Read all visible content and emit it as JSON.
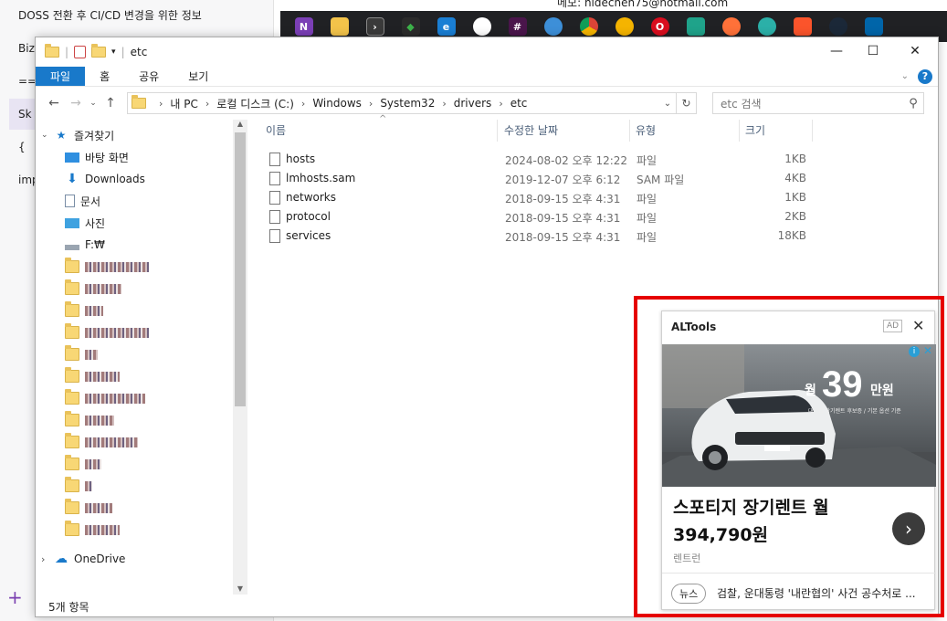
{
  "background_app": {
    "lines": [
      "DOSS 전환 후 CI/CD 변경을 위한 정보",
      "Biz",
      "==",
      "Sk",
      "{",
      "imp"
    ],
    "email": "메모: hidechen75@hotmail.com",
    "add_symbol": "+"
  },
  "taskbar": {
    "icons": [
      "onenote",
      "file-explorer",
      "terminal",
      "git",
      "edge",
      "chrome-dev",
      "slack",
      "bing",
      "chrome",
      "chrome-beta",
      "opera",
      "kakao",
      "firefox",
      "edge-dev",
      "brave",
      "steam",
      "vscode"
    ]
  },
  "explorer": {
    "title": "etc",
    "ribbon": {
      "tabs": [
        "파일",
        "홈",
        "공유",
        "보기"
      ]
    },
    "address": {
      "crumbs": [
        "내 PC",
        "로컬 디스크 (C:)",
        "Windows",
        "System32",
        "drivers",
        "etc"
      ],
      "search_placeholder": "etc 검색"
    },
    "nav": {
      "quick_access_label": "즐겨찾기",
      "items": [
        {
          "label": "바탕 화면",
          "icon": "desktop-icon"
        },
        {
          "label": "Downloads",
          "icon": "downloads-icon"
        },
        {
          "label": "문서",
          "icon": "documents-icon"
        },
        {
          "label": "사진",
          "icon": "pictures-icon"
        },
        {
          "label": "F:₩",
          "icon": "drive-icon"
        }
      ],
      "onedrive_label": "OneDrive"
    },
    "columns": {
      "name": "이름",
      "modified": "수정한 날짜",
      "type": "유형",
      "size": "크기"
    },
    "files": [
      {
        "name": "hosts",
        "modified": "2024-08-02 오후 12:22",
        "type": "파일",
        "size": "1KB"
      },
      {
        "name": "lmhosts.sam",
        "modified": "2019-12-07 오후 6:12",
        "type": "SAM 파일",
        "size": "4KB"
      },
      {
        "name": "networks",
        "modified": "2018-09-15 오후 4:31",
        "type": "파일",
        "size": "1KB"
      },
      {
        "name": "protocol",
        "modified": "2018-09-15 오후 4:31",
        "type": "파일",
        "size": "2KB"
      },
      {
        "name": "services",
        "modified": "2018-09-15 오후 4:31",
        "type": "파일",
        "size": "18KB"
      }
    ],
    "status": "5개 항목"
  },
  "ad": {
    "title": "ALTools",
    "badge": "AD",
    "price_number": "39",
    "price_prefix": "월",
    "price_suffix": "만원",
    "price_subline": "대기업 장기렌트 후보증 / 기본 옵션 기준",
    "headline_line1": "스포티지 장기렌트 월",
    "headline_line2": "394,790원",
    "advertiser": "렌트런",
    "news_badge": "뉴스",
    "news_text": "검찰, 운대통령 '내란협의' 사건 공수처로 ..."
  },
  "colors": {
    "accent": "#1979ca",
    "highlight_border": "#e60000",
    "taskbar": "#202124"
  }
}
